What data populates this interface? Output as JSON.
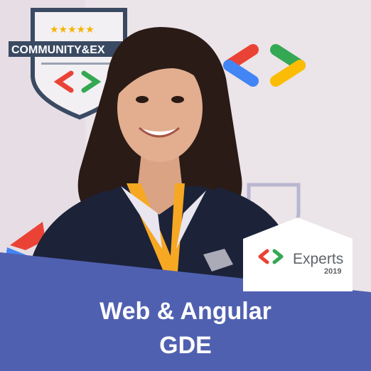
{
  "caption": {
    "line1": "Web & Angular",
    "line2": "GDE"
  },
  "badge": {
    "title": "Experts",
    "year": "2019",
    "icon": "developers-chevron-logo"
  },
  "backdrop": {
    "sign_text": "COMMUNITY&EX"
  },
  "colors": {
    "banner": "#5060b0",
    "google_blue": "#4285f4",
    "google_red": "#ea4335",
    "google_green": "#34a853",
    "google_yellow": "#fbbc05",
    "lanyard": "#f7a823"
  }
}
